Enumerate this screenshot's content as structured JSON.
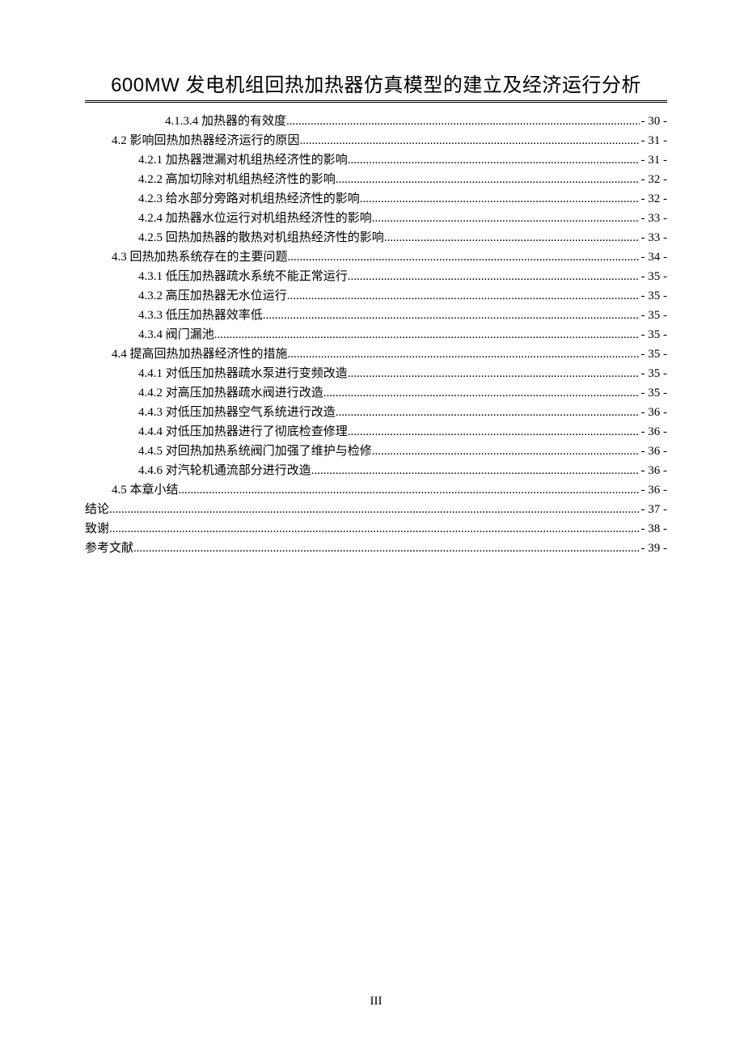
{
  "title": "600MW 发电机组回热加热器仿真模型的建立及经济运行分析",
  "toc": [
    {
      "level": 3,
      "label": "4.1.3.4  加热器的有效度",
      "page": "- 30 -"
    },
    {
      "level": 1,
      "label": "4.2  影响回热加热器经济运行的原因",
      "page": "- 31 -"
    },
    {
      "level": 2,
      "label": "4.2.1  加热器泄漏对机组热经济性的影响",
      "page": "- 31 -"
    },
    {
      "level": 2,
      "label": "4.2.2  高加切除对机组热经济性的影响",
      "page": "- 32 -"
    },
    {
      "level": 2,
      "label": "4.2.3  给水部分旁路对机组热经济性的影响",
      "page": "- 32 -"
    },
    {
      "level": 2,
      "label": "4.2.4  加热器水位运行对机组热经济性的影响",
      "page": "- 33 -"
    },
    {
      "level": 2,
      "label": "4.2.5  回热加热器的散热对机组热经济性的影响",
      "page": "- 33 -"
    },
    {
      "level": 1,
      "label": "4.3  回热加热系统存在的主要问题",
      "page": "- 34 -"
    },
    {
      "level": 2,
      "label": "4.3.1  低压加热器疏水系统不能正常运行",
      "page": "- 35 -"
    },
    {
      "level": 2,
      "label": "4.3.2  高压加热器无水位运行",
      "page": "- 35 -"
    },
    {
      "level": 2,
      "label": "4.3.3  低压加热器效率低",
      "page": "- 35 -"
    },
    {
      "level": 2,
      "label": "4.3.4  阀门漏池",
      "page": "- 35 -"
    },
    {
      "level": 1,
      "label": "4.4  提高回热加热器经济性的措施",
      "page": "- 35 -"
    },
    {
      "level": 2,
      "label": "4.4.1  对低压加热器疏水泵进行变频改造",
      "page": "- 35 -"
    },
    {
      "level": 2,
      "label": "4.4.2  对高压加热器疏水阀进行改造",
      "page": "- 35 -"
    },
    {
      "level": 2,
      "label": "4.4.3  对低压加热器空气系统进行改造",
      "page": "- 36 -"
    },
    {
      "level": 2,
      "label": "4.4.4  对低压加热器进行了彻底检查修理",
      "page": "- 36 -"
    },
    {
      "level": 2,
      "label": "4.4.5  对回热加热系统阀门加强了维护与检修",
      "page": "- 36 -"
    },
    {
      "level": 2,
      "label": "4.4.6  对汽轮机通流部分进行改造",
      "page": "- 36 -"
    },
    {
      "level": 1,
      "label": "4.5  本章小结",
      "page": "- 36 -"
    },
    {
      "level": 0,
      "label": "结论",
      "page": "- 37 -"
    },
    {
      "level": 0,
      "label": "致谢",
      "page": "- 38 -"
    },
    {
      "level": 0,
      "label": "参考文献",
      "page": "- 39 -"
    }
  ],
  "pageNumber": "III"
}
